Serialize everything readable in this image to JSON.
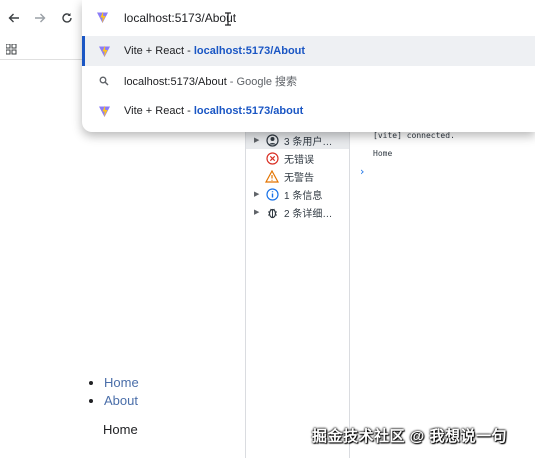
{
  "toolbar": {
    "back_icon": "arrow-left-icon",
    "forward_icon": "arrow-right-icon",
    "reload_icon": "reload-icon",
    "apps_icon": "apps-grid-icon"
  },
  "omnibox": {
    "input_value": "localhost:5173/About",
    "suggestions": [
      {
        "title": "Vite + React",
        "sep": " - ",
        "url": "localhost:5173/About",
        "icon": "vite-icon"
      },
      {
        "title": "localhost:5173/About",
        "sep": " - ",
        "desc": "Google 搜索",
        "icon": "search-icon"
      },
      {
        "title": "Vite + React",
        "sep": " - ",
        "url": "localhost:5173/about",
        "icon": "vite-icon"
      }
    ]
  },
  "page": {
    "nav_links": [
      "Home",
      "About"
    ],
    "content": "Home"
  },
  "devtools": {
    "sidebar": [
      {
        "label": "3 条用户…",
        "icon": "user-icon",
        "expandable": true
      },
      {
        "label": "无错误",
        "icon": "error-icon",
        "expandable": false
      },
      {
        "label": "无警告",
        "icon": "warning-icon",
        "expandable": false
      },
      {
        "label": "1 条信息",
        "icon": "info-icon",
        "expandable": true
      },
      {
        "label": "2 条详细…",
        "icon": "bug-icon",
        "expandable": true
      }
    ],
    "console_lines": [
      "[vite] connected.",
      "Home"
    ],
    "prompt": "›"
  },
  "watermark": "掘金技术社区 @ 我想说一句",
  "colors": {
    "accent": "#1a56c4",
    "link": "#4a6ea9",
    "error": "#d93025",
    "warning": "#e37400",
    "info": "#1a73e8"
  }
}
